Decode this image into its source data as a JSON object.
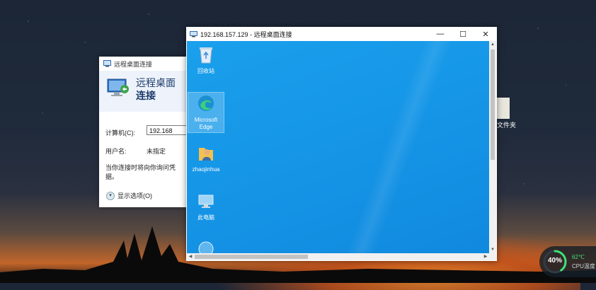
{
  "background_desktop": {
    "partial_icon_label": "文件夹"
  },
  "rdc_dialog": {
    "title": "远程桌面连接",
    "header_line1": "远程桌面",
    "header_line2": "连接",
    "computer_label": "计算机(C):",
    "computer_value": "192.168",
    "username_label": "用户名:",
    "username_value": "未指定",
    "info_text": "当你连接时将向你询问凭据。",
    "show_options": "显示选项(O)"
  },
  "remote_window": {
    "title": "192.168.157.129 - 远程桌面连接",
    "minimize": "—",
    "maximize": "☐",
    "close": "✕",
    "desktop_icons": [
      {
        "label": "回收站",
        "icon": "recycle-bin-icon"
      },
      {
        "label": "Microsoft Edge",
        "icon": "edge-icon"
      },
      {
        "label": "zhaojinhua",
        "icon": "user-folder-icon"
      },
      {
        "label": "此电脑",
        "icon": "this-pc-icon"
      },
      {
        "label": "",
        "icon": "network-icon"
      }
    ]
  },
  "cpu_widget": {
    "percent": "40%",
    "percent_value": 40,
    "temperature": "62℃",
    "label": "CPU温度",
    "accent": "#3ee07a"
  },
  "colors": {
    "remote_desktop_blue": "#1594e6",
    "dialog_header": "#eef3fb"
  }
}
